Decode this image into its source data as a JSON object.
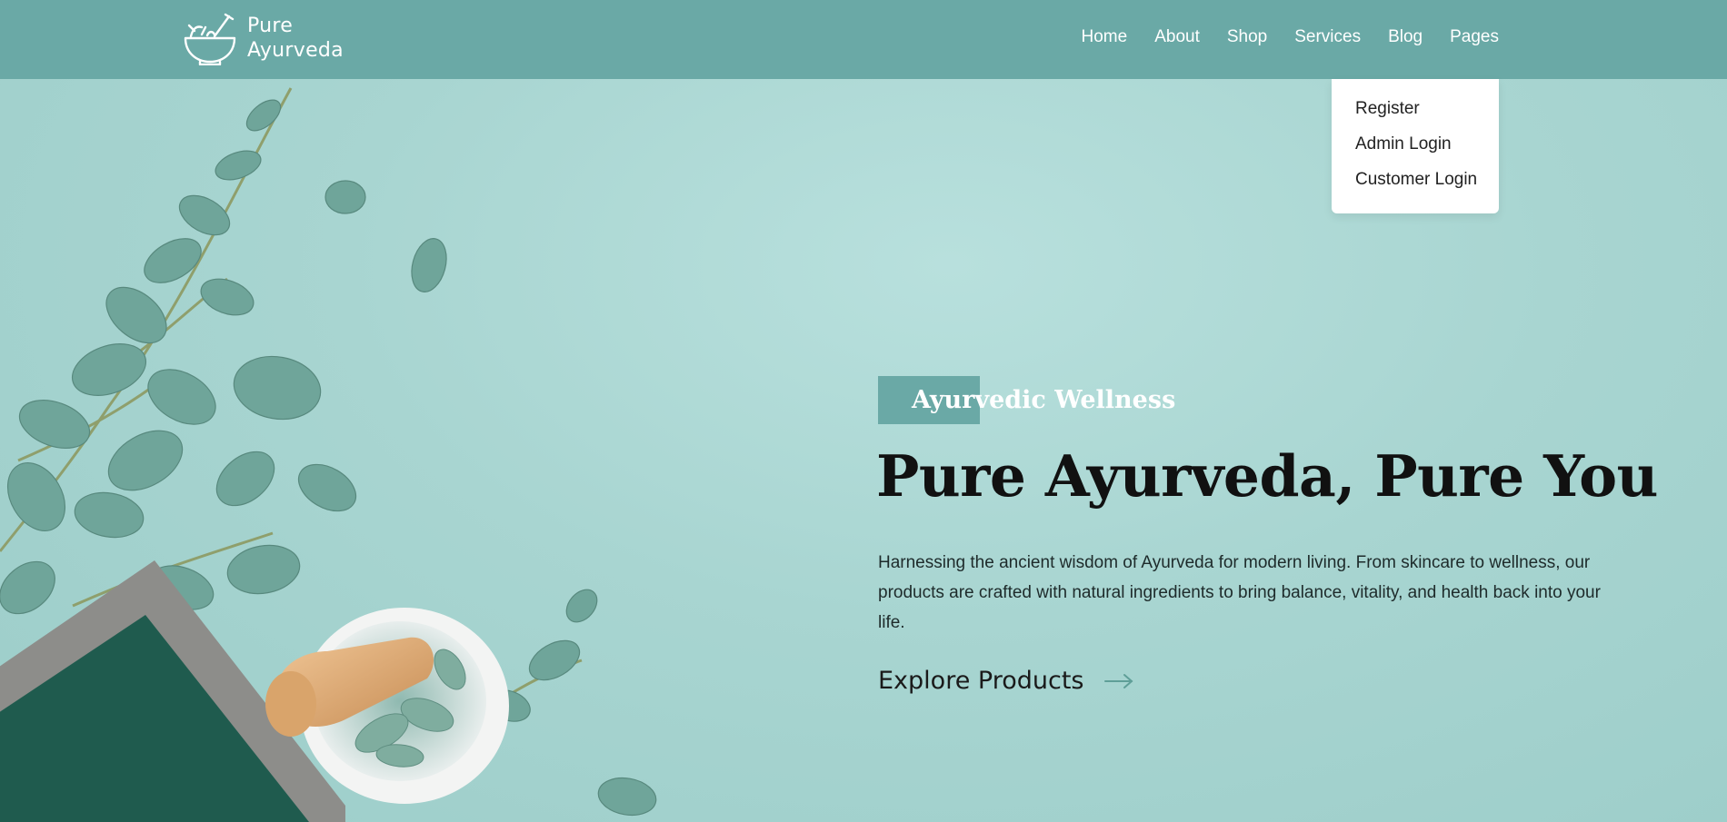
{
  "brand": {
    "name_line1": "Pure",
    "name_line2": "Ayurveda",
    "logo_icon": "mortar-pestle-icon"
  },
  "nav": {
    "items": [
      {
        "label": "Home"
      },
      {
        "label": "About"
      },
      {
        "label": "Shop"
      },
      {
        "label": "Services"
      },
      {
        "label": "Blog"
      },
      {
        "label": "Pages"
      }
    ]
  },
  "dropdown": {
    "items": [
      {
        "label": "Register"
      },
      {
        "label": "Admin Login"
      },
      {
        "label": "Customer Login"
      }
    ]
  },
  "hero": {
    "tagline": "Ayurvedic Wellness",
    "title": "Pure Ayurveda, Pure You",
    "description": "Harnessing the ancient wisdom of Ayurveda for modern living. From skincare to wellness, our products are crafted with natural ingredients to bring balance, vitality, and health back into your life.",
    "cta_label": "Explore Products",
    "cta_icon": "arrow-right-icon"
  },
  "colors": {
    "header_bg": "#6aa9a6",
    "hero_bg": "#a9d6d3",
    "accent": "#6aa9a6"
  }
}
